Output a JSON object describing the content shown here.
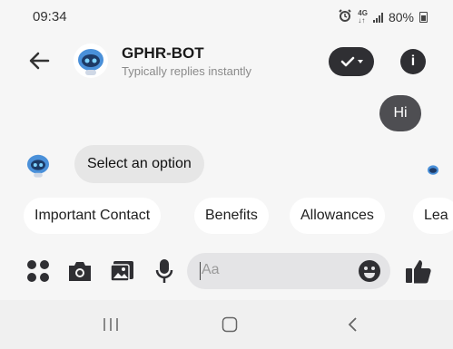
{
  "status_bar": {
    "time": "09:34",
    "network_top": "4G",
    "network_bottom": "↓↑",
    "battery": "80%"
  },
  "header": {
    "title": "GPHR-BOT",
    "subtitle": "Typically replies instantly",
    "info_symbol": "i"
  },
  "messages": {
    "user_message": "Hi",
    "bot_message": "Select an option"
  },
  "quick_replies": [
    "Important Contact",
    "Benefits",
    "Allowances",
    "Lea"
  ],
  "composer": {
    "placeholder": "Aa"
  },
  "colors": {
    "dark": "#2f2f33",
    "bubble_user": "#4e4e52",
    "bubble_bot": "#e6e6e6",
    "bot_blue": "#4a90d9"
  },
  "icons": [
    "back-arrow-icon",
    "checkmark-icon",
    "info-icon",
    "menu-dots-icon",
    "camera-icon",
    "gallery-icon",
    "microphone-icon",
    "emoji-icon",
    "thumbs-up-icon",
    "recent-apps-icon",
    "home-icon",
    "nav-back-icon"
  ]
}
